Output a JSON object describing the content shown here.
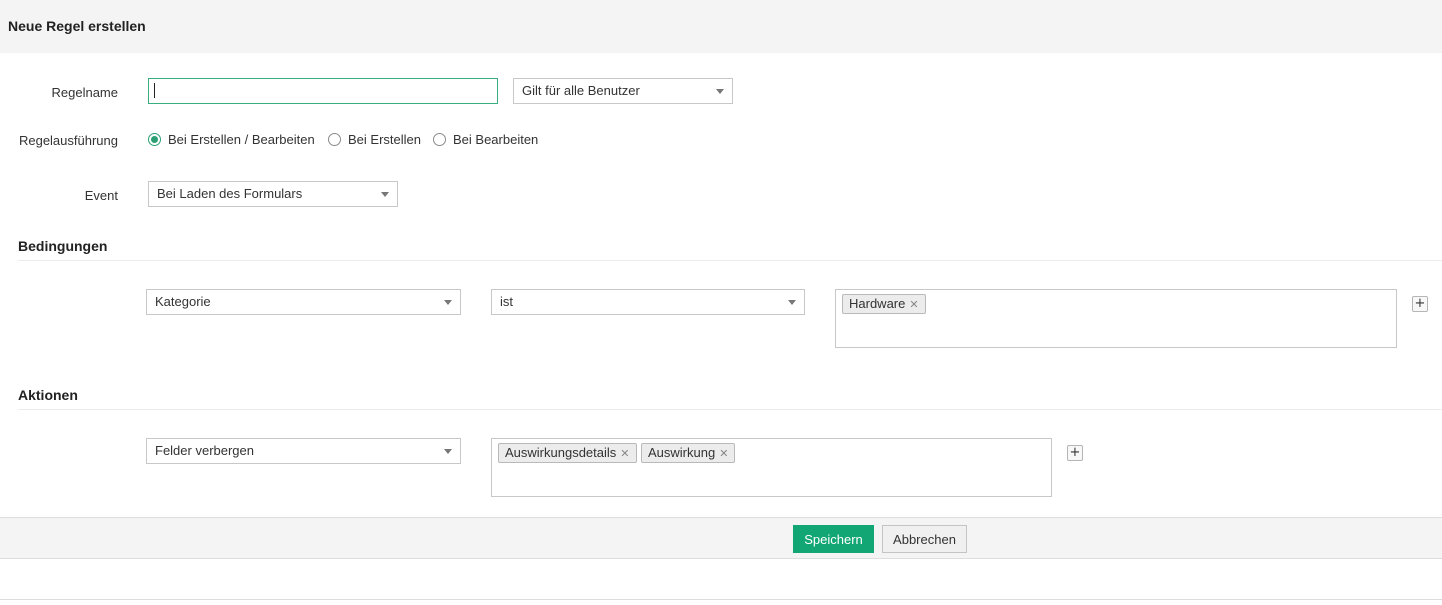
{
  "header": {
    "title": "Neue Regel erstellen"
  },
  "form": {
    "rule_name": {
      "label": "Regelname",
      "value": "",
      "placeholder": ""
    },
    "scope_select": {
      "value": "Gilt für alle Benutzer"
    },
    "execution": {
      "label": "Regelausführung",
      "options": [
        {
          "label": "Bei Erstellen / Bearbeiten",
          "checked": true
        },
        {
          "label": "Bei Erstellen",
          "checked": false
        },
        {
          "label": "Bei Bearbeiten",
          "checked": false
        }
      ]
    },
    "event": {
      "label": "Event",
      "value": "Bei Laden des Formulars"
    }
  },
  "conditions": {
    "title": "Bedingungen",
    "field": "Kategorie",
    "operator": "ist",
    "values": [
      "Hardware"
    ]
  },
  "actions": {
    "title": "Aktionen",
    "action": "Felder verbergen",
    "fields": [
      "Auswirkungsdetails",
      "Auswirkung"
    ]
  },
  "footer": {
    "save_label": "Speichern",
    "cancel_label": "Abbrechen"
  },
  "icons": {
    "add": "plus-icon",
    "remove": "close-icon",
    "dropdown": "chevron-down-icon"
  },
  "colors": {
    "accent": "#12a674",
    "radio": "#2b9f74",
    "focus_border": "#3aad7e"
  }
}
